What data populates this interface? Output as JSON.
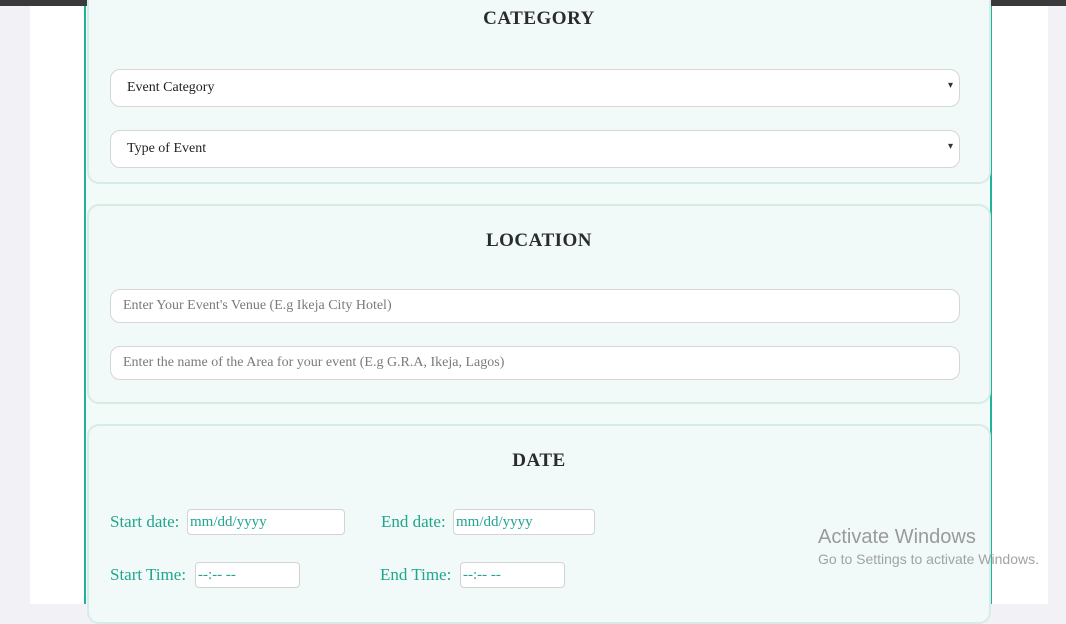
{
  "category": {
    "title": "CATEGORY",
    "event_category_select": {
      "value": "Event Category",
      "caret": "▾"
    },
    "event_type_select": {
      "value": "Type of Event",
      "caret": "▾"
    }
  },
  "location": {
    "title": "LOCATION",
    "venue_input": {
      "placeholder": "Enter Your Event's Venue (E.g Ikeja City Hotel)"
    },
    "area_input": {
      "placeholder": "Enter the name of the Area for your event (E.g G.R.A, Ikeja, Lagos)"
    }
  },
  "date": {
    "title": "DATE",
    "start_date": {
      "label": "Start date:",
      "placeholder": "mm/dd/yyyy"
    },
    "end_date": {
      "label": "End date:",
      "placeholder": "mm/dd/yyyy"
    },
    "start_time": {
      "label": "Start Time:",
      "placeholder": "--:-- --"
    },
    "end_time": {
      "label": "End Time:",
      "placeholder": "--:-- --"
    }
  },
  "os_watermark": {
    "title": "Activate Windows",
    "subtitle": "Go to Settings to activate Windows."
  },
  "colors": {
    "accent": "#20b39a",
    "label_teal": "#20a58f",
    "card_bg": "#f1faf8"
  }
}
